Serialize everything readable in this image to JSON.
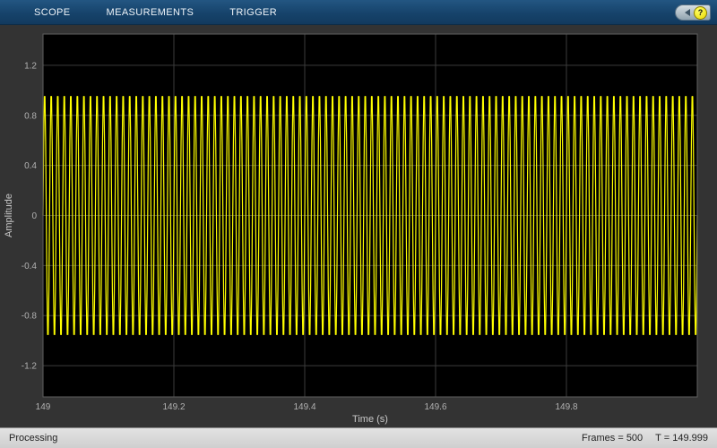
{
  "toolbar": {
    "tabs": [
      {
        "label": "SCOPE"
      },
      {
        "label": "MEASUREMENTS"
      },
      {
        "label": "TRIGGER"
      }
    ],
    "help_label": "?"
  },
  "status_bar": {
    "left": "Processing",
    "frames": "Frames = 500",
    "time": "T = 149.999"
  },
  "colors": {
    "toolbar_blue": "#16436b",
    "waveform_yellow": "#ffff00",
    "plot_background": "#000000",
    "grid_gray": "#3c3c3c",
    "axes_border_gray": "#5f5f5f",
    "status_bar_gray": "#d9d9d9"
  },
  "chart_data": {
    "type": "line",
    "title": "",
    "xlabel": "Time (s)",
    "ylabel": "Amplitude",
    "xlim": [
      149,
      150
    ],
    "ylim": [
      -1.45,
      1.45
    ],
    "xticks": [
      149,
      149.2,
      149.4,
      149.6,
      149.8
    ],
    "xtick_labels": [
      "149",
      "149.2",
      "149.4",
      "149.6",
      "149.8"
    ],
    "yticks": [
      1.2,
      0.8,
      0.4,
      0,
      -0.4,
      -0.8,
      -1.2
    ],
    "ytick_labels": [
      "1.2",
      "0.8",
      "0.4",
      "0",
      "-0.4",
      "-0.8",
      "-1.2"
    ],
    "grid": true,
    "grid_color": "#3c3c3c",
    "axes_color": "#5f5f5f",
    "background": "#000000",
    "line_color": "#ffff00",
    "legend": null,
    "signal": {
      "waveform": "sine",
      "amplitude": 1,
      "frequency_hz": 100,
      "sample_rate_hz": 1000,
      "description": "Unit-amplitude 100 Hz sine sampled at 1 kHz, shown from t = 149 s to t = 150 s (dense yellow band spanning -1 to +1)"
    }
  }
}
